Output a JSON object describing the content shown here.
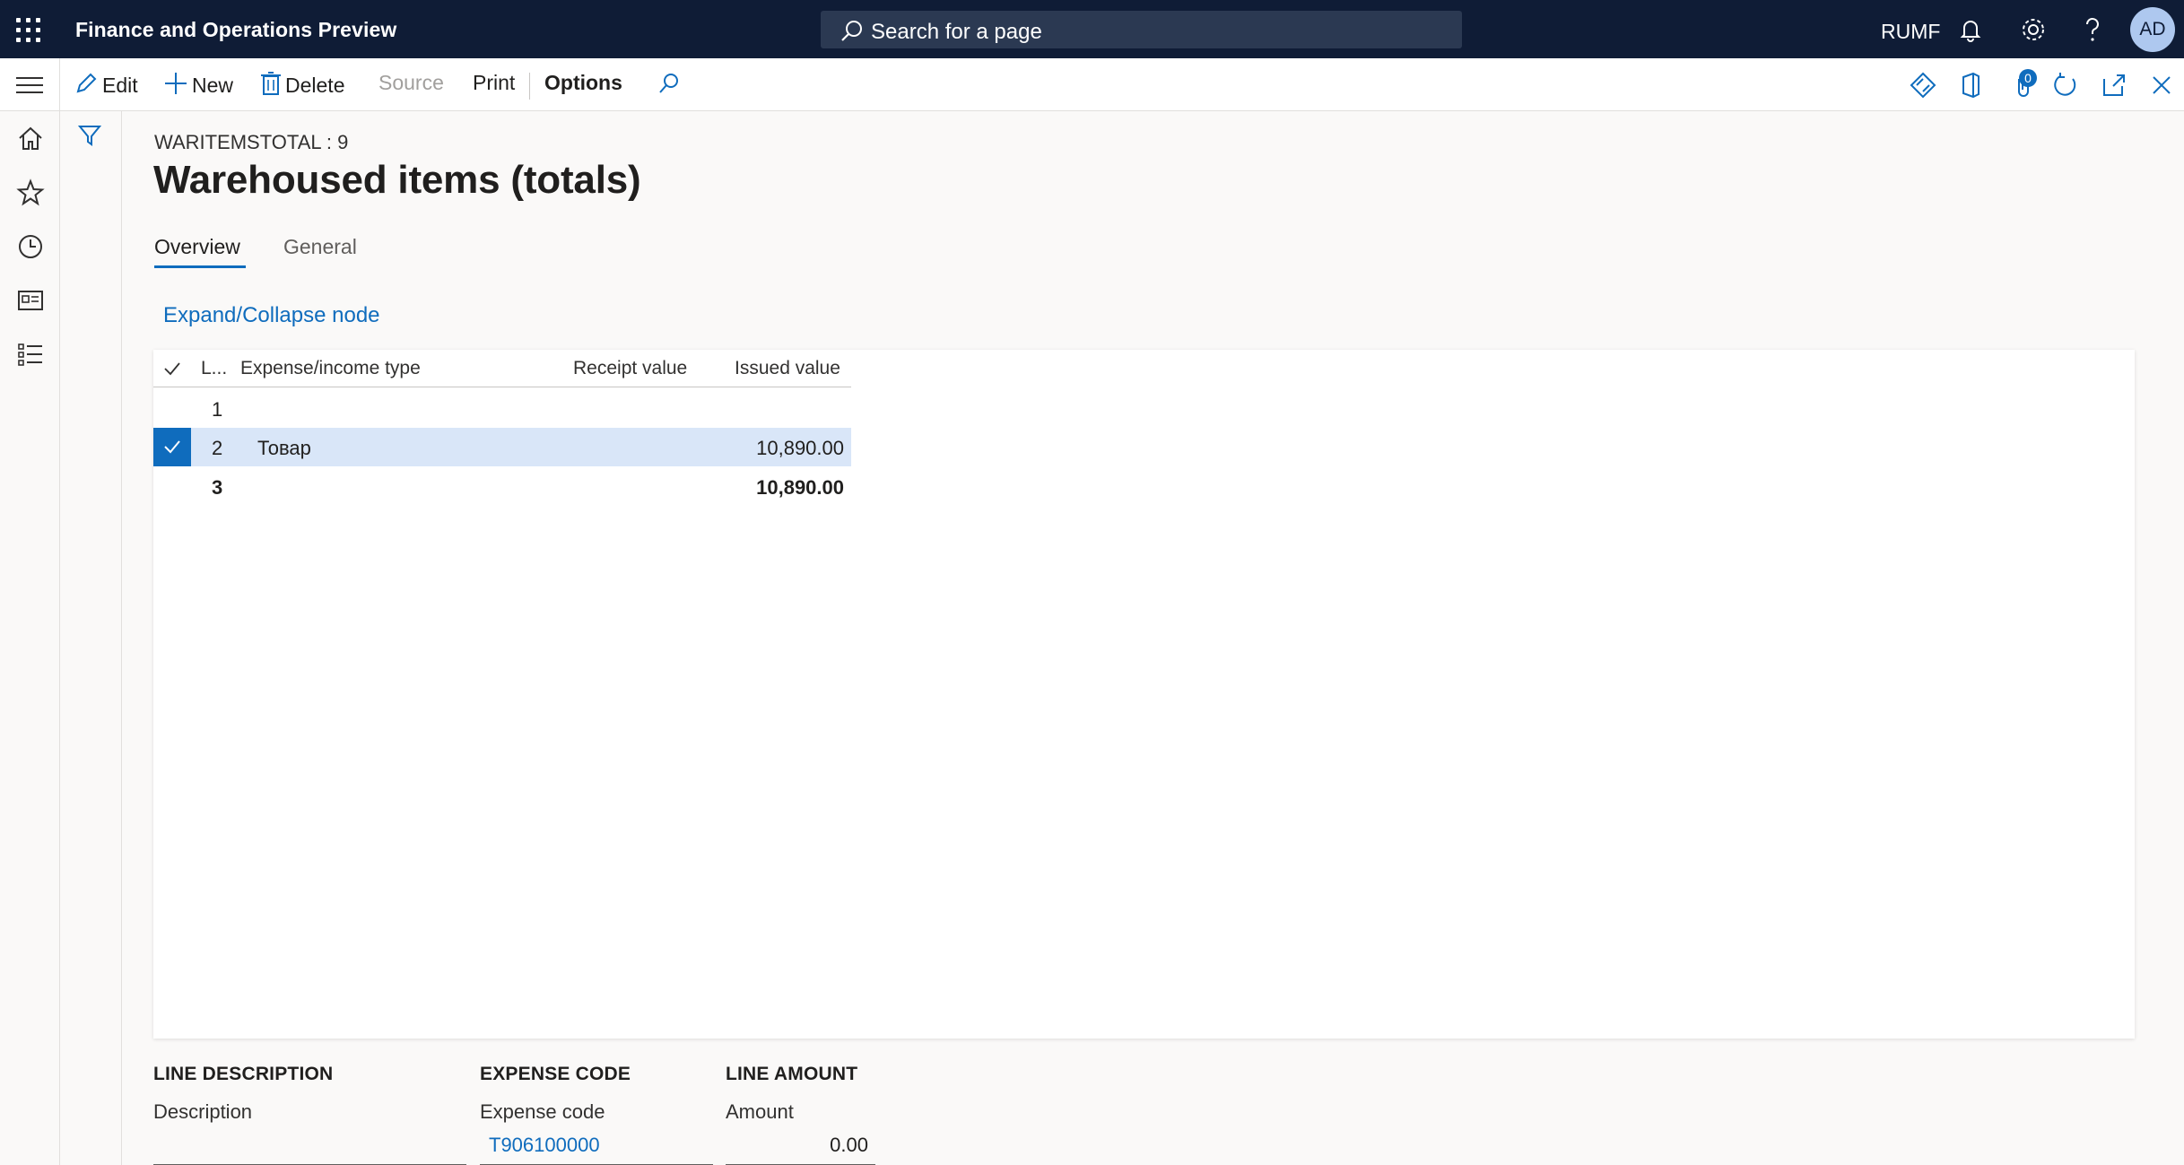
{
  "header": {
    "app_title": "Finance and Operations Preview",
    "search_placeholder": "Search for a page",
    "company": "RUMF",
    "avatar_initials": "AD"
  },
  "action_pane": {
    "edit": "Edit",
    "new": "New",
    "delete": "Delete",
    "source": "Source",
    "print": "Print",
    "options": "Options",
    "attachments_count": "0"
  },
  "page": {
    "caption": "WARITEMSTOTAL : 9",
    "title": "Warehoused items (totals)",
    "tabs": [
      {
        "label": "Overview",
        "active": true
      },
      {
        "label": "General",
        "active": false
      }
    ],
    "expand_collapse_label": "Expand/Collapse node"
  },
  "grid": {
    "columns": {
      "line": "L...",
      "expense_type": "Expense/income type",
      "receipt_value": "Receipt value",
      "issued_value": "Issued value"
    },
    "rows": [
      {
        "line": "1",
        "expense_type": "",
        "receipt_value": "",
        "issued_value": "",
        "selected": false,
        "total": false
      },
      {
        "line": "2",
        "expense_type": "Товар",
        "receipt_value": "",
        "issued_value": "10,890.00",
        "selected": true,
        "total": false
      },
      {
        "line": "3",
        "expense_type": "",
        "receipt_value": "",
        "issued_value": "10,890.00",
        "selected": false,
        "total": true
      }
    ]
  },
  "field_groups": {
    "line_description": {
      "title": "LINE DESCRIPTION",
      "label": "Description",
      "value": ""
    },
    "expense_code": {
      "title": "EXPENSE CODE",
      "label": "Expense code",
      "value": "T906100000"
    },
    "line_amount": {
      "title": "LINE AMOUNT",
      "label": "Amount",
      "value": "0.00"
    }
  },
  "colors": {
    "nav_bg": "#0f1c36",
    "accent": "#0f6cbd",
    "selected_row": "#d9e6f8"
  }
}
